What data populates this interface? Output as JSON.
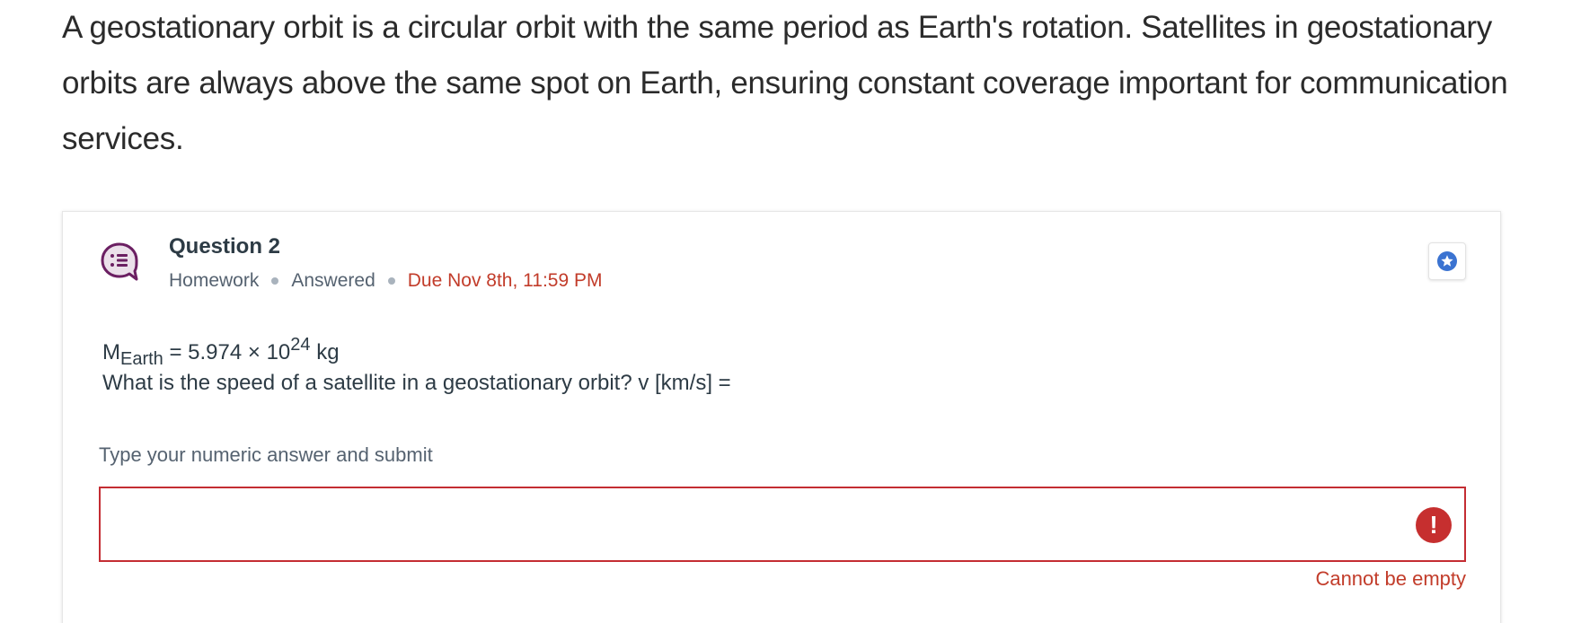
{
  "intro": {
    "text": "A geostationary orbit is a circular orbit with the same period as Earth's rotation. Satellites in geostationary orbits are always above the same spot on Earth, ensuring constant coverage important for communication services."
  },
  "question": {
    "icon": "question-chat-icon",
    "title": "Question 2",
    "type": "Homework",
    "status": "Answered",
    "due": "Due Nov 8th, 11:59 PM",
    "star_icon": "star-icon",
    "given": {
      "symbol": "M",
      "subscript": "Earth",
      "equals": " = 5.974 × 10",
      "exponent": "24",
      "unit": " kg"
    },
    "prompt": "What is the speed of a satellite in a geostationary orbit? v [km/s] ="
  },
  "answer": {
    "label": "Type your numeric answer and submit",
    "value": "",
    "placeholder": "",
    "error_icon": "exclamation-icon",
    "error_glyph": "!",
    "error_message": "Cannot be empty"
  },
  "colors": {
    "accent_purple": "#6b1f62",
    "star_blue": "#3b73d1",
    "error_red": "#c42d33",
    "due_red": "#c23c2a"
  }
}
